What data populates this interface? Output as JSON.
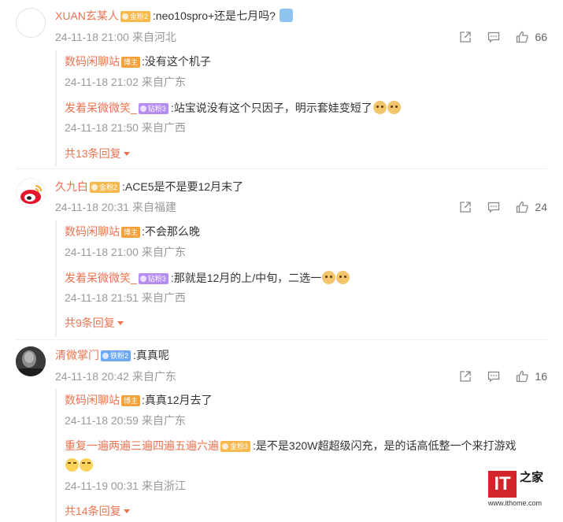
{
  "comments": [
    {
      "user": "XUAN玄某人",
      "badge": "金粉2",
      "text": ":neo10spro+还是七月吗?",
      "meta": "24-11-18 21:00 来自河北",
      "likes": "66",
      "replies": [
        {
          "user": "数码闲聊站",
          "badge": "博主",
          "text": ":没有这个机子",
          "meta": "24-11-18 21:02 来自广东"
        },
        {
          "user": "发着呆微微笑_",
          "badge": "钻粉3",
          "text": ":站宝说没有这个只因子，明示套娃变短了",
          "meta": "24-11-18 21:50 来自广西"
        }
      ],
      "more": "共13条回复"
    },
    {
      "user": "久九白",
      "badge": "金粉2",
      "text": ":ACE5是不是要12月末了",
      "meta": "24-11-18 20:31 来自福建",
      "likes": "24",
      "replies": [
        {
          "user": "数码闲聊站",
          "badge": "博主",
          "text": ":不会那么晚",
          "meta": "24-11-18 21:00 来自广东"
        },
        {
          "user": "发着呆微微笑_",
          "badge": "钻粉3",
          "text": ":那就是12月的上/中旬，二选一",
          "meta": "24-11-18 21:51 来自广西"
        }
      ],
      "more": "共9条回复"
    },
    {
      "user": "清微掌门",
      "badge": "铁粉2",
      "text": ":真真呢",
      "meta": "24-11-18 20:42 来自广东",
      "likes": "16",
      "replies": [
        {
          "user": "数码闲聊站",
          "badge": "博主",
          "text": ":真真12月去了",
          "meta": "24-11-18 20:59 来自广东"
        },
        {
          "user": "重复一遍两遍三遍四遍五遍六遍",
          "badge": "金粉3",
          "text": ":是不是320W超超级闪充，是的话高低整一个来打游戏",
          "meta": "24-11-19 00:31 来自浙江"
        }
      ],
      "more": "共14条回复"
    }
  ],
  "watermark": {
    "logo_text": "IT",
    "logo_char": "之家",
    "url": "www.ithome.com"
  },
  "colors": {
    "accent": "#eb7350",
    "meta": "#999999",
    "badge_gold": "#f7b94e",
    "badge_blue": "#6fa8f2",
    "badge_purple": "#b58cf2",
    "badge_host": "#f4a13a",
    "logo_red": "#d1252b"
  }
}
